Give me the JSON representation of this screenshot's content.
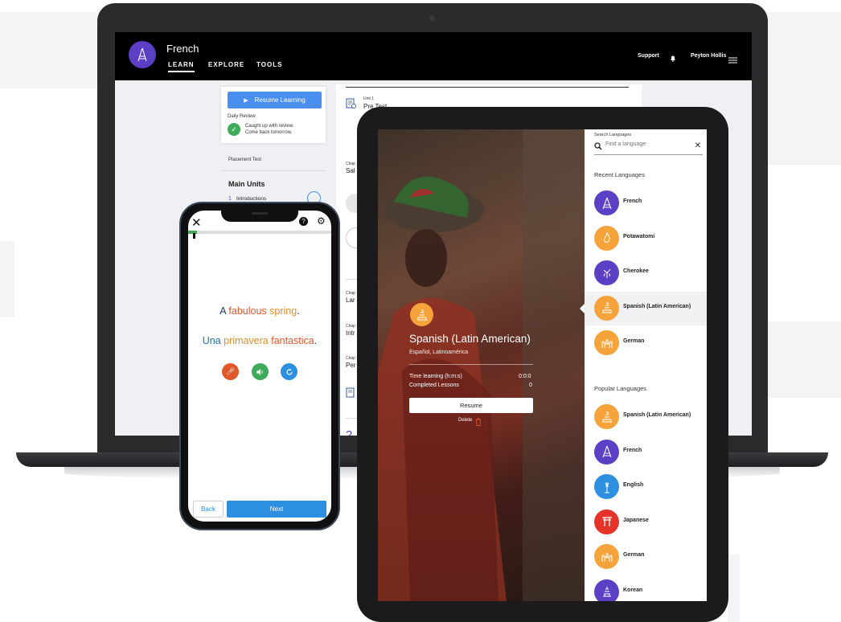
{
  "laptop": {
    "language": "French",
    "nav": [
      "LEARN",
      "EXPLORE",
      "TOOLS"
    ],
    "support": "Support",
    "user": "Peyton Hollis",
    "resume_label": "Resume Learning",
    "daily_review": "Daily Review",
    "review_status": "Caught up with review.",
    "review_sub": "Come back tomorrow.",
    "placement_test": "Placement Test",
    "main_units": "Main Units",
    "unit_1_num": "1",
    "unit_1": "Introductions",
    "unit_label": "Unit 1",
    "pre_test": "Pre Test",
    "chapters": [
      {
        "label": "Chap",
        "title": "Sal"
      },
      {
        "label": "Chap",
        "title": "Lar"
      },
      {
        "label": "Chap",
        "title": "Intr"
      },
      {
        "label": "Chap",
        "title": "Per"
      }
    ],
    "unit_2_num": "2"
  },
  "phone": {
    "english_sentence": [
      {
        "text": "A ",
        "color": "#1f3a5a"
      },
      {
        "text": "fabulous ",
        "color": "#e0572a"
      },
      {
        "text": "spring",
        "color": "#e58f2a"
      },
      {
        "text": ".",
        "color": "#1f3a5a"
      }
    ],
    "target_sentence": [
      {
        "text": "Una ",
        "color": "#1f6fa8"
      },
      {
        "text": "primavera ",
        "color": "#e58f2a"
      },
      {
        "text": "fantastica",
        "color": "#e0572a"
      },
      {
        "text": ".",
        "color": "#1f3a5a"
      }
    ],
    "back_label": "Back",
    "next_label": "Next",
    "progress_fraction": 0.06
  },
  "tablet": {
    "language_title": "Spanish (Latin American)",
    "language_native": "Español, Latinoamérica",
    "time_label": "Time learning (h:m:s)",
    "time_value": "0:0:0",
    "lessons_label": "Completed Lessons",
    "lessons_value": "0",
    "resume_label": "Resume",
    "delete_label": "Delete",
    "search_title": "Search Languages",
    "search_placeholder": "Find a language",
    "recent_title": "Recent Languages",
    "recent": [
      {
        "name": "French",
        "color": "#5b3fc4",
        "icon": "eiffel-icon"
      },
      {
        "name": "Potawatomi",
        "color": "#f5a33a",
        "icon": "flame-icon"
      },
      {
        "name": "Cherokee",
        "color": "#5b3fc4",
        "icon": "plant-icon"
      },
      {
        "name": "Spanish (Latin American)",
        "color": "#f5a33a",
        "icon": "temple-icon"
      },
      {
        "name": "German",
        "color": "#f5a33a",
        "icon": "castle-icon"
      }
    ],
    "popular_title": "Popular Languages",
    "popular": [
      {
        "name": "Spanish (Latin American)",
        "color": "#f5a33a",
        "icon": "temple-icon"
      },
      {
        "name": "French",
        "color": "#5b3fc4",
        "icon": "eiffel-icon"
      },
      {
        "name": "English",
        "color": "#2d8fe0",
        "icon": "liberty-icon"
      },
      {
        "name": "Japanese",
        "color": "#e5332a",
        "icon": "torii-icon"
      },
      {
        "name": "German",
        "color": "#f5a33a",
        "icon": "castle-icon"
      },
      {
        "name": "Korean",
        "color": "#5b3fc4",
        "icon": "pagoda-icon"
      }
    ]
  }
}
